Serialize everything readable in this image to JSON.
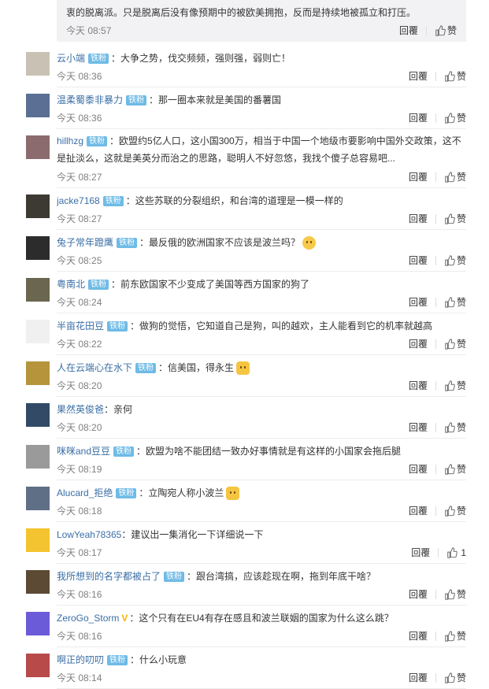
{
  "previous": {
    "text": "衷的脱离派。只是脱离后没有像预期中的被欧美拥抱，反而是持续地被孤立和打压。",
    "time": "今天 08:57",
    "reply": "回覆",
    "like": "赞"
  },
  "comments": [
    {
      "name": "云小端",
      "badge": "铁粉",
      "text": "：大争之势，伐交频频，强则强，弱则亡！",
      "time": "今天 08:36",
      "reply": "回覆",
      "like": "赞",
      "avatar_color": "#c9c2b4"
    },
    {
      "name": "温柔蜀黍非暴力",
      "badge": "铁粉",
      "text": "：那一圈本来就是美国的番薯国",
      "time": "今天 08:36",
      "reply": "回覆",
      "like": "赞",
      "avatar_color": "#5a6f93"
    },
    {
      "name": "hillhzg",
      "badge": "铁粉",
      "text": "：欧盟约5亿人口，这小国300万，相当于中国一个地级市要影响中国外交政策，这不是扯淡么，这就是美英分而治之的思路，聪明人不好忽悠，我找个傻子总容易吧...",
      "time": "今天 08:27",
      "reply": "回覆",
      "like": "赞",
      "avatar_color": "#8b6b6e"
    },
    {
      "name": "jacke7168",
      "badge": "铁粉",
      "text": "：这些苏联的分裂组织，和台湾的道理是一模一样的",
      "time": "今天 08:27",
      "reply": "回覆",
      "like": "赞",
      "avatar_color": "#3d3a33"
    },
    {
      "name": "兔子常年蹬鹰",
      "badge": "铁粉",
      "text": "：最反俄的欧洲国家不应该是波兰吗？",
      "time": "今天 08:25",
      "reply": "回覆",
      "like": "赞",
      "avatar_color": "#2c2c2c"
    },
    {
      "name": "粤南北",
      "badge": "铁粉",
      "text": "：前东欧国家不少变成了美国等西方国家的狗了",
      "time": "今天 08:24",
      "reply": "回覆",
      "like": "赞",
      "avatar_color": "#6b6650"
    },
    {
      "name": "半亩花田豆",
      "badge": "铁粉",
      "text": "：做狗的觉悟，它知道自己是狗，叫的越欢，主人能看到它的机率就越高",
      "time": "今天 08:22",
      "reply": "回覆",
      "like": "赞",
      "avatar_color": "#f0f0f0"
    },
    {
      "name": "人在云端心在水下",
      "badge": "铁粉",
      "text": "：信美国，得永生",
      "time": "今天 08:20",
      "reply": "回覆",
      "like": "赞",
      "avatar_color": "#b5943c"
    },
    {
      "name": "果然英俊爸",
      "badge": "",
      "text": "：亲何",
      "time": "今天 08:20",
      "reply": "回覆",
      "like": "赞",
      "avatar_color": "#324a66"
    },
    {
      "name": "咪咪and豆豆",
      "badge": "铁粉",
      "text": "：欧盟为啥不能团结一致办好事情就是有这样的小国家会拖后腿",
      "time": "今天 08:19",
      "reply": "回覆",
      "like": "赞",
      "avatar_color": "#9a9a9a"
    },
    {
      "name": "Alucard_拒绝",
      "badge": "铁粉",
      "text": "：立陶宛人称小波兰",
      "time": "今天 08:18",
      "reply": "回覆",
      "like": "赞",
      "avatar_color": "#5f6f86"
    },
    {
      "name": "LowYeah78365",
      "badge": "",
      "text": "：建议出一集消化一下详细说一下",
      "time": "今天 08:17",
      "reply": "回覆",
      "like": "",
      "like_count": "1",
      "avatar_color": "#f4c430"
    },
    {
      "name": "我所想到的名字都被占了",
      "badge": "铁粉",
      "text": "：跟台湾搞，应该趁现在啊，拖到年底干啥？",
      "time": "今天 08:16",
      "reply": "回覆",
      "like": "赞",
      "avatar_color": "#5c4a34"
    },
    {
      "name": "ZeroGo_Storm",
      "badge": "",
      "vbadge": "V",
      "text": "：这个只有在EU4有存在感且和波兰联姻的国家为什么这么跳？",
      "time": "今天 08:16",
      "reply": "回覆",
      "like": "赞",
      "avatar_color": "#6b5bd8"
    },
    {
      "name": "啊正的叨叨",
      "badge": "铁粉",
      "text": "：什么小玩意",
      "time": "今天 08:14",
      "reply": "回覆",
      "like": "赞",
      "avatar_color": "#b84a4a"
    }
  ]
}
